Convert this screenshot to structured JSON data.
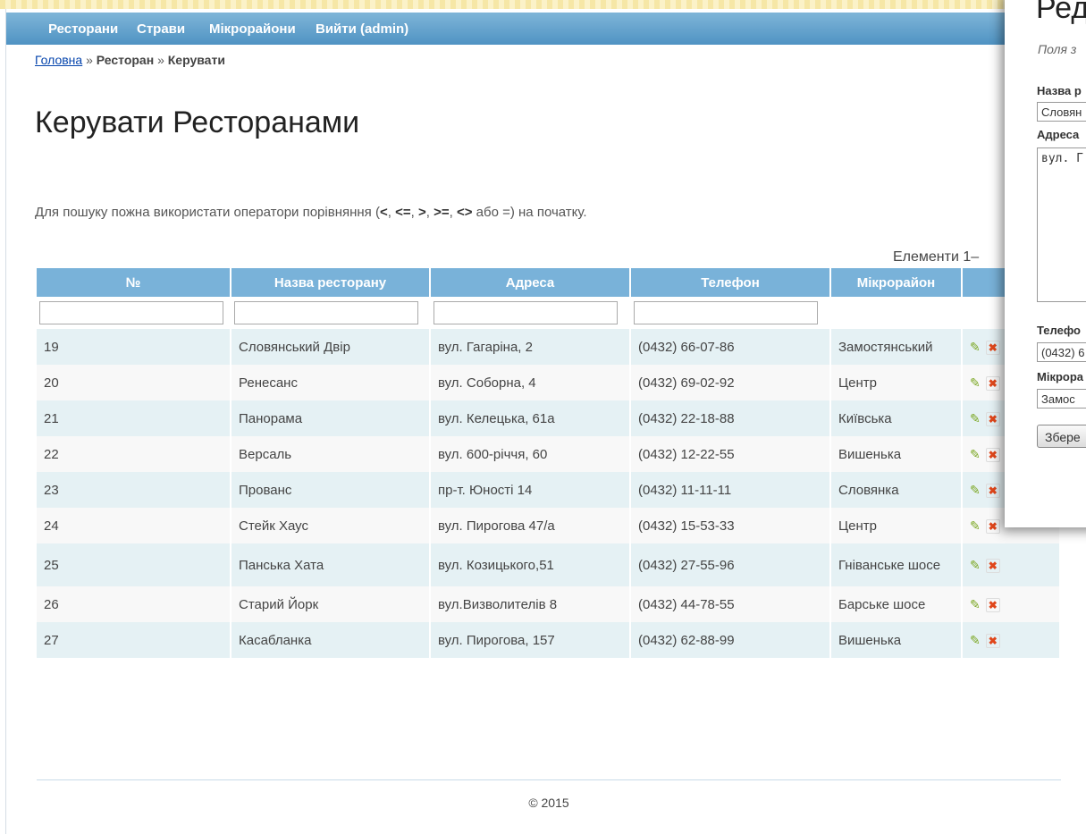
{
  "menu": {
    "items": [
      "Ресторани",
      "Страви",
      "Мікрорайони",
      "Вийти (admin)"
    ]
  },
  "breadcrumb": {
    "home": "Головна",
    "sep": "»",
    "restaurant": "Ресторан",
    "current": "Керувати"
  },
  "page": {
    "title": "Керувати Ресторанами",
    "hint_start": "Для пошуку пожна використати оператори порівняння (",
    "hint_ops": [
      "<",
      "<=",
      ">",
      ">=",
      "<>"
    ],
    "hint_or": "або",
    "hint_eq": "=",
    "hint_end": ") на початку.",
    "summary": "Елементи 1–"
  },
  "table": {
    "headers": [
      "№",
      "Назва ресторану",
      "Адреса",
      "Телефон",
      "Мікрорайон",
      ""
    ],
    "rows": [
      {
        "id": "19",
        "name": "Словянський Двір",
        "address": "вул. Гагаріна, 2",
        "phone": "(0432) 66-07-86",
        "district": "Замостянський"
      },
      {
        "id": "20",
        "name": "Ренесанс",
        "address": "вул. Соборна, 4",
        "phone": "(0432) 69-02-92",
        "district": "Центр"
      },
      {
        "id": "21",
        "name": "Панорама",
        "address": "вул. Келецька, 61а",
        "phone": "(0432) 22-18-88",
        "district": "Київська"
      },
      {
        "id": "22",
        "name": "Версаль",
        "address": "вул. 600-річчя, 60",
        "phone": "(0432) 12-22-55",
        "district": "Вишенька"
      },
      {
        "id": "23",
        "name": "Прованс",
        "address": "пр-т. Юності 14",
        "phone": "(0432) 11-11-11",
        "district": "Словянка"
      },
      {
        "id": "24",
        "name": "Стейк Хаус",
        "address": "вул. Пирогова 47/а",
        "phone": "(0432) 15-53-33",
        "district": "Центр"
      },
      {
        "id": "25",
        "name": "Панська Хата",
        "address": "вул. Козицького,51",
        "phone": "(0432) 27-55-96",
        "district": "Гніванське шосе"
      },
      {
        "id": "26",
        "name": "Старий Йорк",
        "address": "вул.Визволителів 8",
        "phone": "(0432) 44-78-55",
        "district": "Барське шосе"
      },
      {
        "id": "27",
        "name": "Касабланка",
        "address": "вул. Пирогова, 157",
        "phone": "(0432) 62-88-99",
        "district": "Вишенька"
      }
    ]
  },
  "icons": {
    "edit": "pencil-icon",
    "delete": "delete-icon"
  },
  "footer": {
    "copyright": "© 2015"
  },
  "dialog": {
    "title": "Ред",
    "note": "Поля з",
    "name_label": "Назва р",
    "name_value": "Словян",
    "address_label": "Адреса",
    "address_value": "вул. Г",
    "phone_label": "Телефо",
    "phone_value": "(0432) 6",
    "district_label": "Мікрора",
    "district_value": "Замос",
    "save_label": "Збере"
  },
  "colors": {
    "menu": "#5b9fcc",
    "header": "#79b2d9",
    "row_odd": "#e5f1f4",
    "row_even": "#f8f8f8",
    "link": "#0645ad"
  }
}
